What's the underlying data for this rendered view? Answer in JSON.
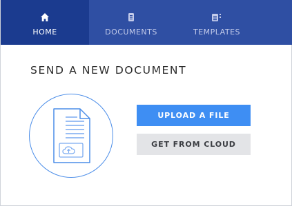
{
  "nav": {
    "tabs": [
      {
        "label": "HOME",
        "icon": "home-icon",
        "active": true
      },
      {
        "label": "DOCUMENTS",
        "icon": "documents-icon",
        "active": false
      },
      {
        "label": "TEMPLATES",
        "icon": "templates-icon",
        "active": false
      }
    ]
  },
  "main": {
    "heading": "SEND A NEW DOCUMENT",
    "illustration_icon": "document-upload-icon",
    "upload_button": "UPLOAD A FILE",
    "cloud_button": "GET FROM CLOUD"
  },
  "colors": {
    "nav_background": "#2f4fa3",
    "nav_active": "#1b3b8f",
    "primary_button": "#3e8ef3",
    "secondary_button": "#e3e4e7",
    "accent_outline": "#4b8de8"
  }
}
